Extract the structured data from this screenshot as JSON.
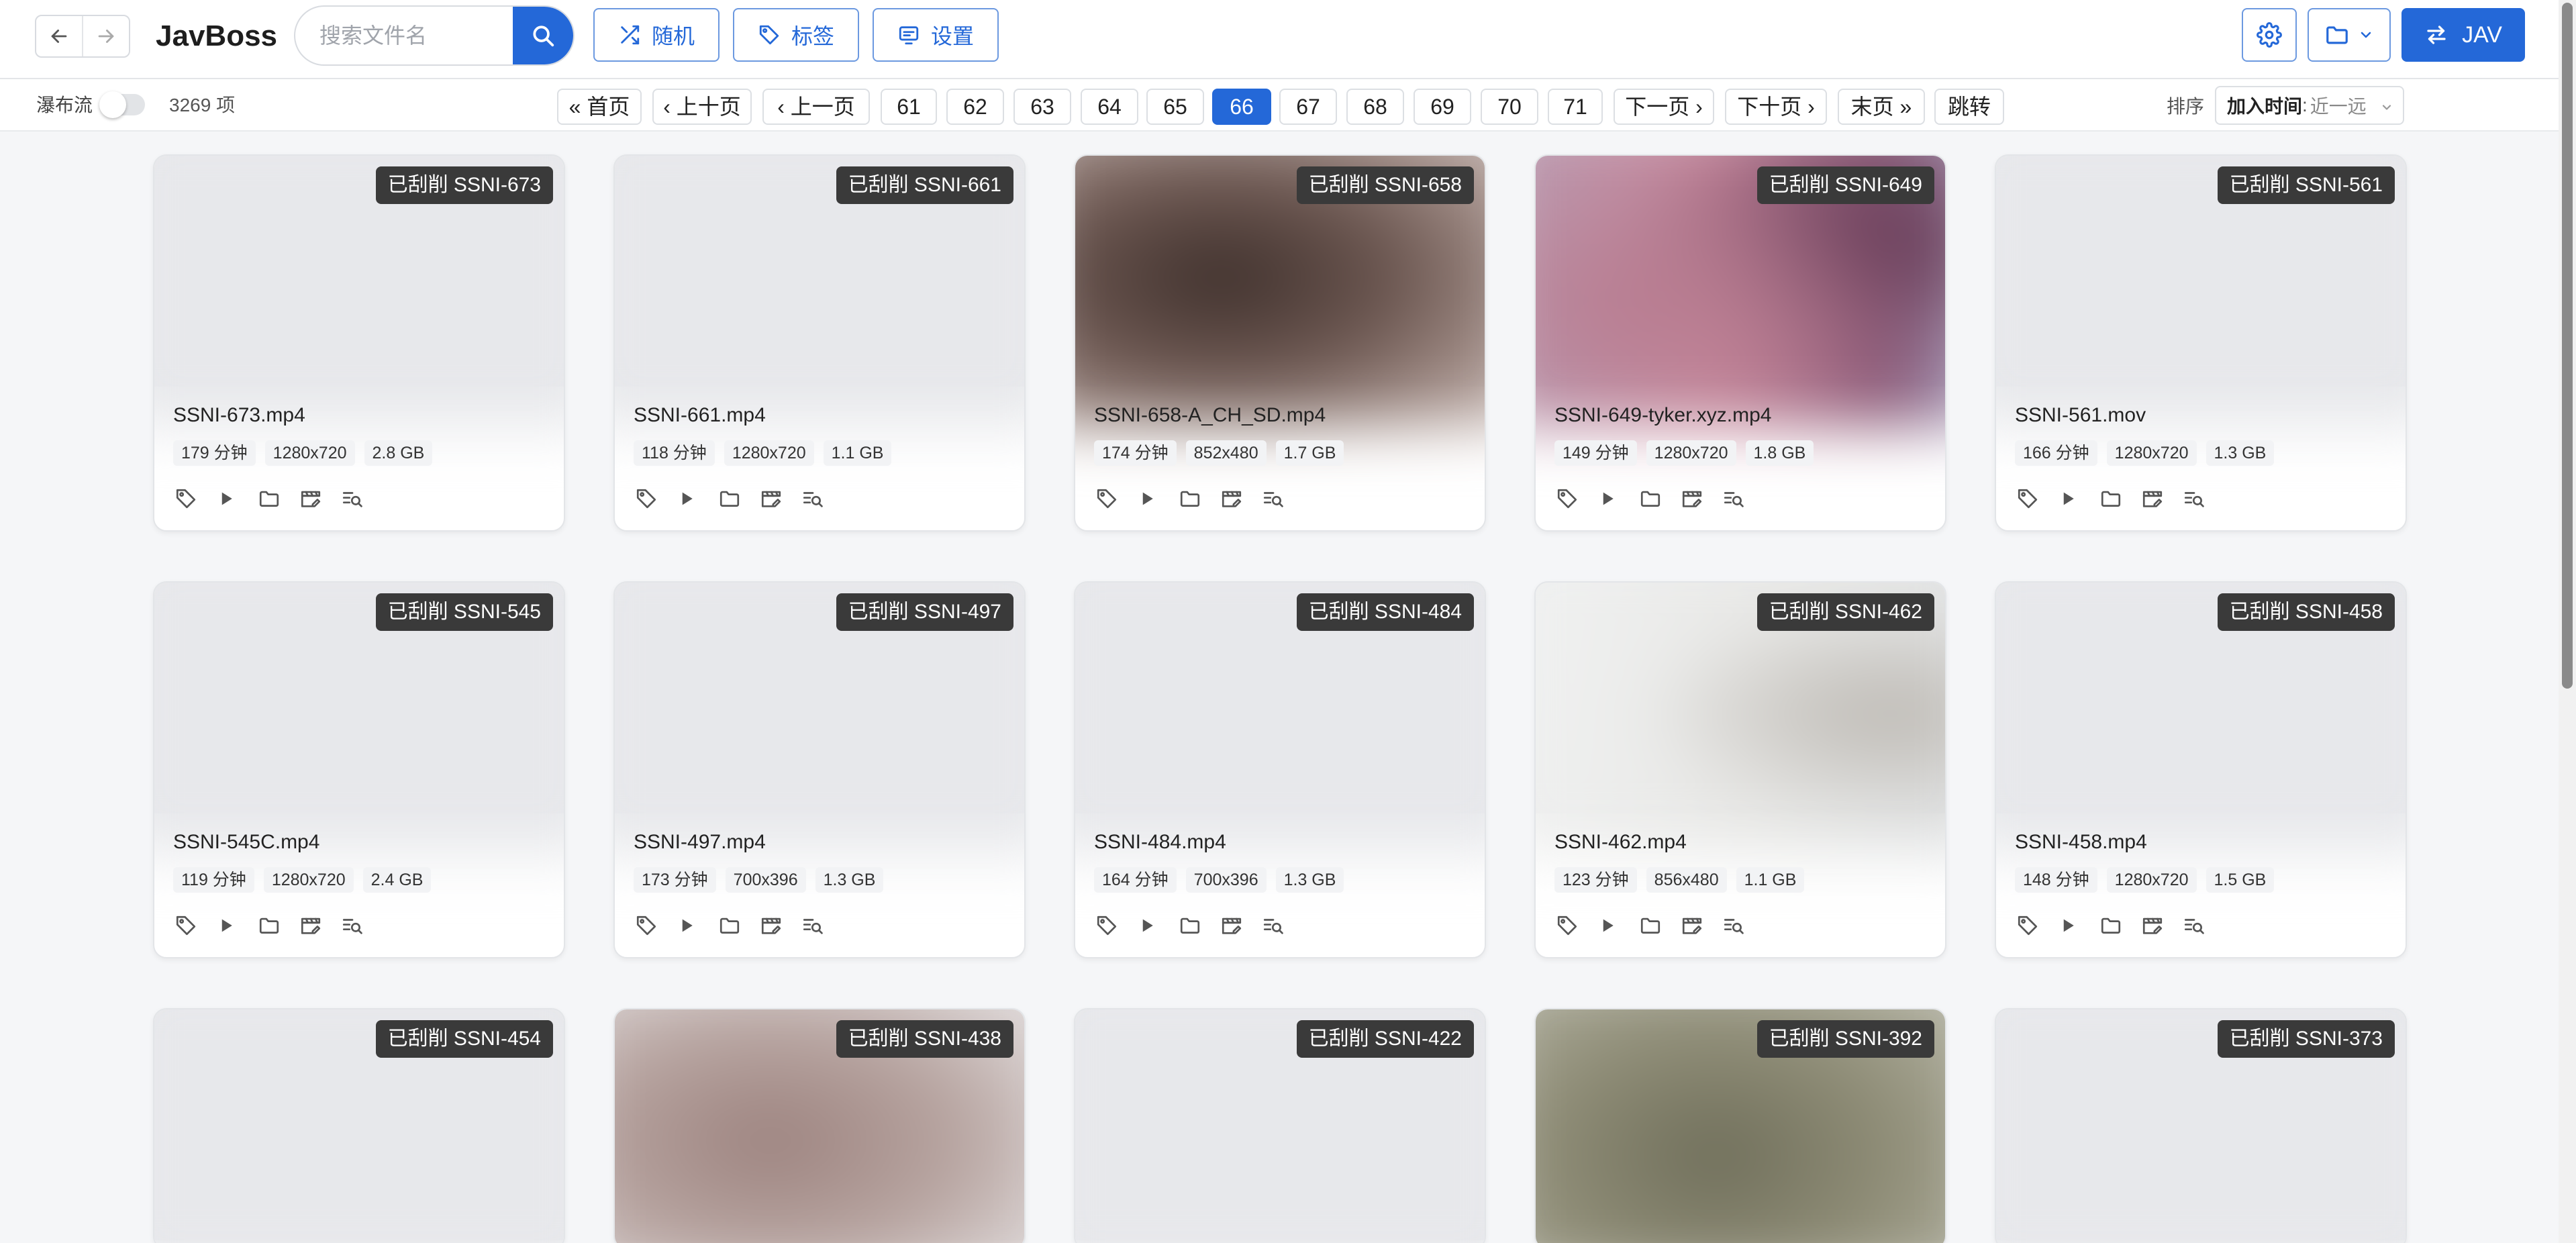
{
  "header": {
    "title": "JavBoss",
    "search_placeholder": "搜索文件名",
    "buttons": {
      "random": "随机",
      "tags": "标签",
      "settings": "设置",
      "jav": "JAV"
    }
  },
  "toolbar": {
    "waterfall_label": "瀑布流",
    "waterfall_on": false,
    "count": "3269 项",
    "sort_label": "排序",
    "sort_key": "加入时间",
    "sort_sep": ":",
    "sort_dir": "近一远"
  },
  "pagination": {
    "first": "« 首页",
    "prev_ten": "‹ 上十页",
    "prev": "‹ 上一页",
    "pages": [
      "61",
      "62",
      "63",
      "64",
      "65",
      "66",
      "67",
      "68",
      "69",
      "70",
      "71"
    ],
    "current": "66",
    "next": "下一页 ›",
    "next_ten": "下十页 ›",
    "last": "末页 »",
    "jump": "跳转"
  },
  "cards": [
    {
      "badge": "已刮削 SSNI-673",
      "filename": "SSNI-673.mp4",
      "duration": "179 分钟",
      "resolution": "1280x720",
      "size": "2.8 GB",
      "thumb": "plain"
    },
    {
      "badge": "已刮削 SSNI-661",
      "filename": "SSNI-661.mp4",
      "duration": "118 分钟",
      "resolution": "1280x720",
      "size": "1.1 GB",
      "thumb": "plain"
    },
    {
      "badge": "已刮削 SSNI-658",
      "filename": "SSNI-658-A_CH_SD.mp4",
      "duration": "174 分钟",
      "resolution": "852x480",
      "size": "1.7 GB",
      "thumb": "brown"
    },
    {
      "badge": "已刮削 SSNI-649",
      "filename": "SSNI-649-tyker.xyz.mp4",
      "duration": "149 分钟",
      "resolution": "1280x720",
      "size": "1.8 GB",
      "thumb": "pink"
    },
    {
      "badge": "已刮削 SSNI-561",
      "filename": "SSNI-561.mov",
      "duration": "166 分钟",
      "resolution": "1280x720",
      "size": "1.3 GB",
      "thumb": "plain"
    },
    {
      "badge": "已刮削 SSNI-545",
      "filename": "SSNI-545C.mp4",
      "duration": "119 分钟",
      "resolution": "1280x720",
      "size": "2.4 GB",
      "thumb": "plain"
    },
    {
      "badge": "已刮削 SSNI-497",
      "filename": "SSNI-497.mp4",
      "duration": "173 分钟",
      "resolution": "700x396",
      "size": "1.3 GB",
      "thumb": "plain"
    },
    {
      "badge": "已刮削 SSNI-484",
      "filename": "SSNI-484.mp4",
      "duration": "164 分钟",
      "resolution": "700x396",
      "size": "1.3 GB",
      "thumb": "plain"
    },
    {
      "badge": "已刮削 SSNI-462",
      "filename": "SSNI-462.mp4",
      "duration": "123 分钟",
      "resolution": "856x480",
      "size": "1.1 GB",
      "thumb": "light"
    },
    {
      "badge": "已刮削 SSNI-458",
      "filename": "SSNI-458.mp4",
      "duration": "148 分钟",
      "resolution": "1280x720",
      "size": "1.5 GB",
      "thumb": "plain"
    },
    {
      "badge": "已刮削 SSNI-454",
      "thumb": "plain"
    },
    {
      "badge": "已刮削 SSNI-438",
      "thumb": "rose"
    },
    {
      "badge": "已刮削 SSNI-422",
      "thumb": "plain"
    },
    {
      "badge": "已刮削 SSNI-392",
      "thumb": "olive"
    },
    {
      "badge": "已刮削 SSNI-373",
      "thumb": "plain"
    }
  ],
  "colors": {
    "accent": "#2468d8",
    "badge_bg": "#3a3a3a",
    "page_bg": "#f5f6f8",
    "thumb_placeholder": "#e7e8eb"
  }
}
